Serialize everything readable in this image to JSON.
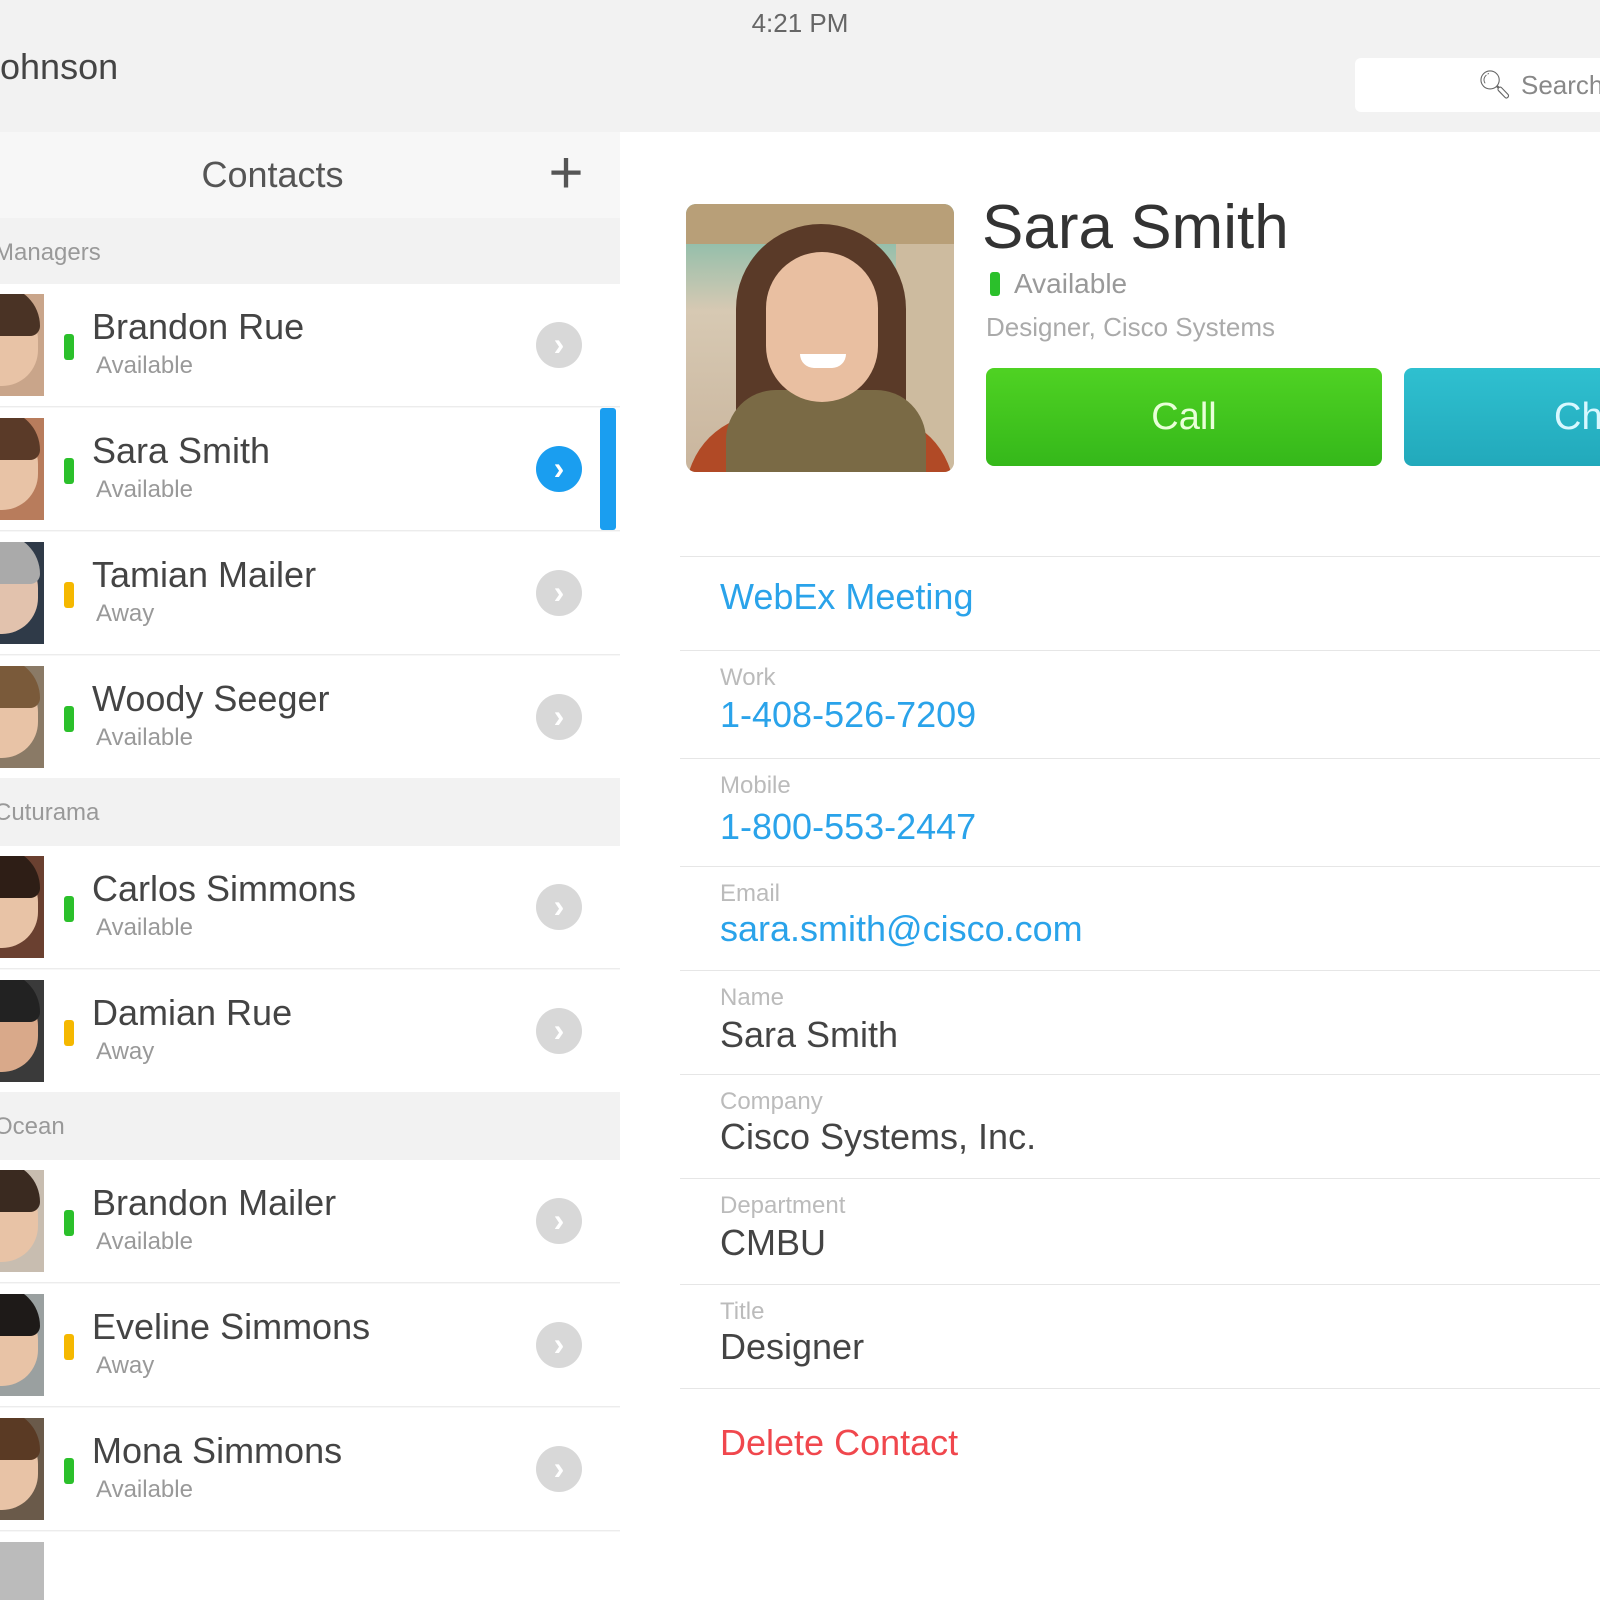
{
  "status_bar": {
    "time": "4:21 PM"
  },
  "header": {
    "user_name": "ohnson",
    "search_placeholder": "Search"
  },
  "contacts": {
    "title": "Contacts",
    "add_label": "+",
    "groups": [
      {
        "label": "Managers",
        "items": [
          {
            "name": "Brandon Rue",
            "status": "Available",
            "presence_color": "#2bc02b"
          },
          {
            "name": "Sara Smith",
            "status": "Available",
            "presence_color": "#2bc02b",
            "selected": true
          },
          {
            "name": "Tamian Mailer",
            "status": "Away",
            "presence_color": "#f5b800"
          },
          {
            "name": "Woody Seeger",
            "status": "Available",
            "presence_color": "#2bc02b"
          }
        ]
      },
      {
        "label": "Cuturama",
        "items": [
          {
            "name": "Carlos Simmons",
            "status": "Available",
            "presence_color": "#2bc02b"
          },
          {
            "name": "Damian Rue",
            "status": "Away",
            "presence_color": "#f5b800"
          }
        ]
      },
      {
        "label": "Ocean",
        "items": [
          {
            "name": "Brandon Mailer",
            "status": "Available",
            "presence_color": "#2bc02b"
          },
          {
            "name": "Eveline Simmons",
            "status": "Away",
            "presence_color": "#f5b800"
          },
          {
            "name": "Mona Simmons",
            "status": "Available",
            "presence_color": "#2bc02b"
          }
        ]
      }
    ]
  },
  "detail": {
    "name": "Sara Smith",
    "status": "Available",
    "title_company": "Designer, Cisco Systems",
    "call_label": "Call",
    "chat_label": "Chat",
    "webex_label": "WebEx Meeting",
    "fields": [
      {
        "label": "Work",
        "value": "1-408-526-7209",
        "link": true
      },
      {
        "label": "Mobile",
        "value": "1-800-553-2447",
        "link": true
      },
      {
        "label": "Email",
        "value": "sara.smith@cisco.com",
        "link": true
      },
      {
        "label": "Name",
        "value": "Sara Smith",
        "link": false
      },
      {
        "label": "Company",
        "value": "Cisco Systems, Inc.",
        "link": false
      },
      {
        "label": "Department",
        "value": "CMBU",
        "link": false
      },
      {
        "label": "Title",
        "value": "Designer",
        "link": false
      }
    ],
    "delete_label": "Delete Contact"
  },
  "colors": {
    "accent": "#1a9ef0",
    "call": "#3ec51e",
    "chat": "#27b4c5",
    "delete": "#f0474d",
    "available": "#2bc02b",
    "away": "#f5b800"
  }
}
